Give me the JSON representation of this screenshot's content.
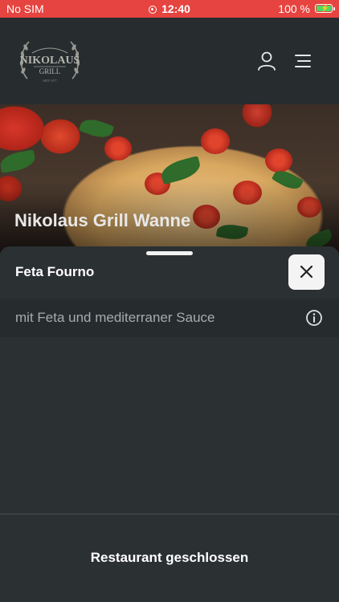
{
  "status_bar": {
    "carrier": "No SIM",
    "time": "12:40",
    "battery": "100 %"
  },
  "header": {
    "logo": {
      "name": "NIKOLAUS",
      "sub": "GRILL",
      "since": "SEIT 1977"
    },
    "icons": [
      "user-icon",
      "menu-icon"
    ]
  },
  "hero": {
    "title": "Nikolaus Grill Wanne"
  },
  "sheet": {
    "title": "Feta Fourno",
    "description": "mit Feta und mediterraner Sauce",
    "footer_text": "Restaurant geschlossen"
  },
  "colors": {
    "status_bar": "#e64440",
    "background": "#252a2d",
    "sheet": "#2b3033",
    "battery_fill": "#4cd964"
  }
}
